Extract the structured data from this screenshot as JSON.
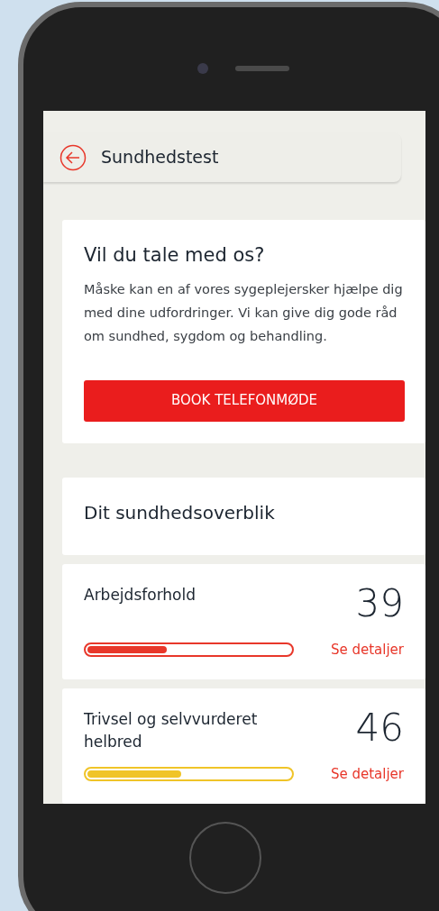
{
  "header": {
    "title": "Sundhedstest"
  },
  "contact_card": {
    "title": "Vil du tale med os?",
    "body": "Måske kan en af vores sygeplejersker hjælpe dig med dine udfordringer. Vi kan give dig gode råd om sundhed, sygdom og behandling.",
    "button": "BOOK TELEFONMØDE"
  },
  "overview": {
    "title": "Dit sundhedsoverblik",
    "items": [
      {
        "label": "Arbejdsforhold",
        "score": "39",
        "level": 0.39,
        "color": "#e8372a",
        "link": "Se detaljer"
      },
      {
        "label": "Trivsel og selvvurderet helbred",
        "score": "46",
        "level": 0.46,
        "color": "#f0c428",
        "link": "Se detaljer"
      }
    ]
  }
}
